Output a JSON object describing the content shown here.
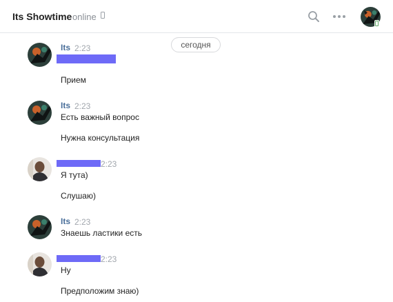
{
  "header": {
    "title": "Its Showtime",
    "status": "online",
    "icons": {
      "search": "search-icon",
      "more": "more-icon",
      "phone": "phone-icon"
    }
  },
  "date_separator": "сегодня",
  "colors": {
    "author": "#4a6f9a",
    "redaction": "#6e6af7",
    "time": "#a1a6ad"
  },
  "messages": [
    {
      "author": "Its",
      "time": "2:23",
      "lines": [
        "Прием"
      ]
    },
    {
      "author": "Its",
      "time": "2:23",
      "lines": [
        "Есть важный вопрос",
        "Нужна консультация"
      ]
    },
    {
      "author": "",
      "time": "2:23",
      "lines": [
        "Я тута)",
        "Слушаю)"
      ]
    },
    {
      "author": "Its",
      "time": "2:23",
      "lines": [
        "Знаешь ластики есть"
      ]
    },
    {
      "author": "",
      "time": "2:23",
      "lines": [
        "Ну",
        "Предположим знаю)"
      ]
    }
  ]
}
